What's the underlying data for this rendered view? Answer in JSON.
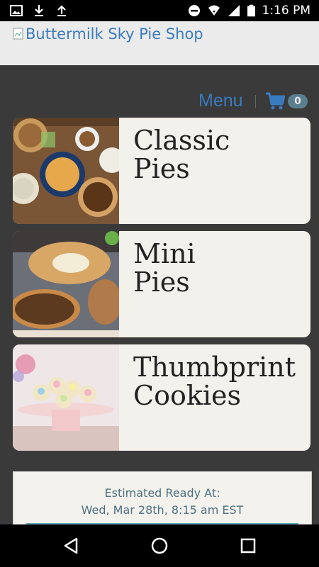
{
  "status_bar": {
    "time": "1:16 PM",
    "left_icons": [
      "image-icon",
      "download-icon",
      "upload-icon"
    ],
    "right_icons": [
      "do-not-disturb-icon",
      "wifi-icon",
      "signal-icon",
      "battery-icon"
    ]
  },
  "header": {
    "logo_alt": "Buttermilk Sky Pie Shop"
  },
  "nav": {
    "menu_label": "Menu",
    "cart_count": "0"
  },
  "categories": [
    {
      "title": "Classic\nPies",
      "image": "classic-pies-photo"
    },
    {
      "title": "Mini\nPies",
      "image": "mini-pies-photo"
    },
    {
      "title": "Thumbprint\nCookies",
      "image": "thumbprint-cookies-photo"
    }
  ],
  "ready": {
    "label": "Estimated Ready At:",
    "time": "Wed, Mar 28th, 8:15 am EST"
  },
  "colors": {
    "link": "#3a7bbf",
    "background": "#3a3a3a",
    "card": "#f3f1ec",
    "badge": "#5a7f90"
  }
}
